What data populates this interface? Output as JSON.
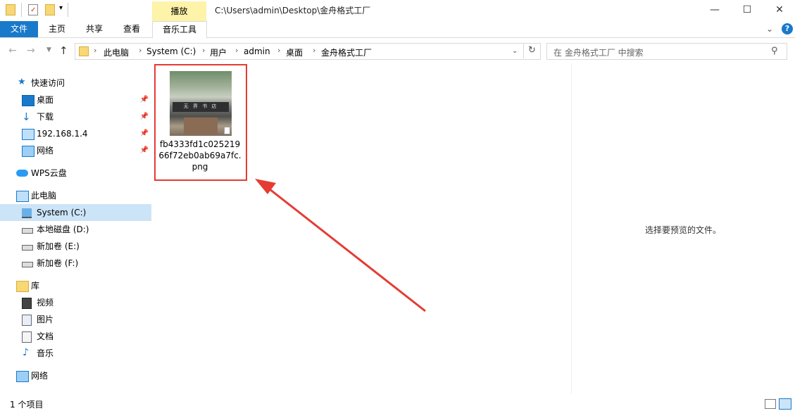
{
  "window": {
    "title_path": "C:\\Users\\admin\\Desktop\\金舟格式工厂",
    "context_tab_label": "播放"
  },
  "ribbon": {
    "tabs": [
      {
        "label": "文件"
      },
      {
        "label": "主页"
      },
      {
        "label": "共享"
      },
      {
        "label": "查看"
      },
      {
        "label": "音乐工具"
      }
    ]
  },
  "address": {
    "crumbs": [
      "此电脑",
      "System (C:)",
      "用户",
      "admin",
      "桌面",
      "金舟格式工厂"
    ]
  },
  "search": {
    "placeholder": "在 金舟格式工厂 中搜索"
  },
  "nav": {
    "quick_access": "快速访问",
    "pinned": [
      "桌面",
      "下载",
      "192.168.1.4",
      "网络"
    ],
    "wps": "WPS云盘",
    "this_pc": "此电脑",
    "drives": [
      "System (C:)",
      "本地磁盘 (D:)",
      "新加卷 (E:)",
      "新加卷 (F:)"
    ],
    "library": "库",
    "library_items": [
      "视频",
      "图片",
      "文档",
      "音乐"
    ],
    "network": "网络"
  },
  "content": {
    "file_name": "fb4333fd1c02521966f72eb0ab69a7fc.png",
    "thumb_sign_text": "无 界 书 店"
  },
  "preview": {
    "message": "选择要预览的文件。"
  },
  "status": {
    "item_count": "1 个项目"
  },
  "colors": {
    "accent": "#1979ca",
    "selection": "#cce4f7",
    "highlight_border": "#e53b33",
    "context_tab": "#fdf3a9"
  }
}
